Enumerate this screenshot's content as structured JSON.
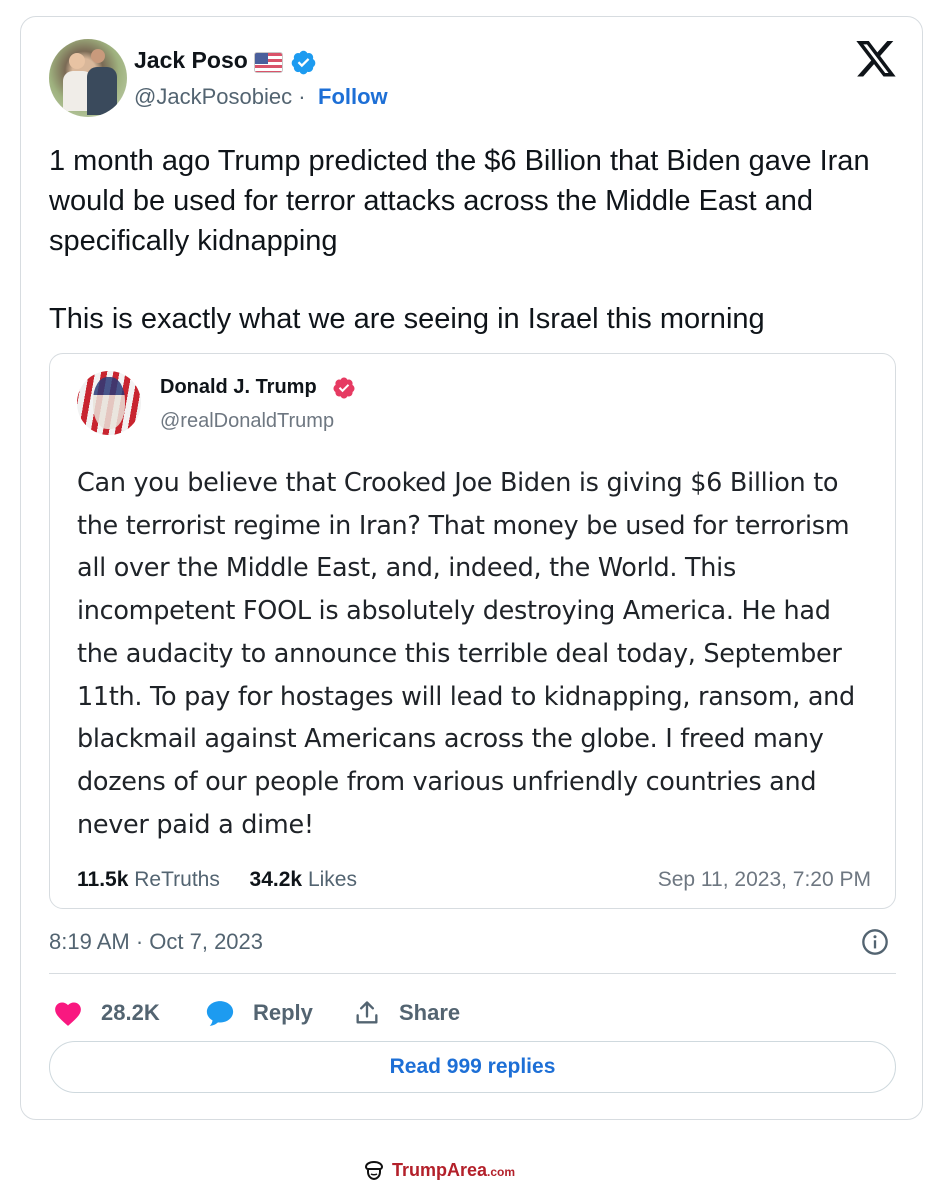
{
  "tweet": {
    "author": {
      "name": "Jack Poso",
      "handle": "@JackPosobiec",
      "separator": "·",
      "follow_label": "Follow",
      "flag_icon": "us-flag-icon",
      "verified_icon": "verified-badge-icon"
    },
    "brand_icon": "x-logo-icon",
    "text": [
      "1 month ago Trump predicted the $6 Billion that Biden gave Iran would be used for terror attacks across the Middle East and specifically kidnapping",
      "This is exactly what we are seeing in Israel this morning"
    ],
    "quoted": {
      "author_name": "Donald J. Trump",
      "author_handle": "@realDonaldTrump",
      "text": "Can you believe that Crooked Joe Biden is giving $6 Billion to the terrorist regime in Iran? That money be used for terrorism all over the Middle East, and, indeed, the World. This incompetent FOOL is absolutely destroying America. He had the audacity to announce this terrible deal today, September 11th. To pay for hostages will lead to kidnapping, ransom, and blackmail against Americans across the globe. I freed many dozens of our people from various unfriendly countries and never paid a dime!",
      "retruths_count": "11.5k",
      "retruths_label": "ReTruths",
      "likes_count": "34.2k",
      "likes_label": "Likes",
      "date": "Sep 11, 2023, 7:20 PM"
    },
    "timestamp": "8:19 AM · Oct 7, 2023",
    "actions": {
      "like_count": "28.2K",
      "reply_label": "Reply",
      "share_label": "Share"
    },
    "read_replies_label": "Read 999 replies"
  },
  "watermark": {
    "brand": "TrumpArea",
    "domain": ".com"
  },
  "colors": {
    "link_blue": "#1d6fd6",
    "verified_blue": "#1d9bf0",
    "like_pink": "#f91880",
    "truth_badge": "#e63a62",
    "text_secondary": "#536471",
    "watermark_red": "#b3202a"
  }
}
